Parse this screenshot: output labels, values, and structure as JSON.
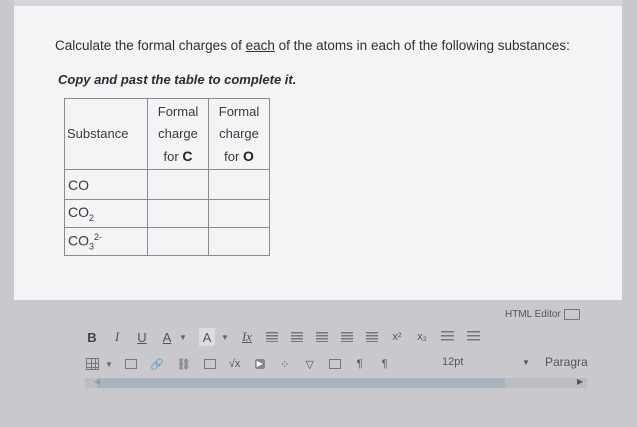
{
  "question": {
    "prompt_before": "Calculate the formal charges of ",
    "prompt_emphasis": "each",
    "prompt_after": " of the atoms in each of the following substances:",
    "instruction": "Copy and past the table to complete it."
  },
  "table": {
    "headers": {
      "substance": "Substance",
      "col1_line1": "Formal",
      "col1_line2": "charge",
      "col1_line3": "for",
      "col1_atom": "C",
      "col2_line1": "Formal",
      "col2_line2": "charge",
      "col2_line3": "for",
      "col2_atom": "O"
    },
    "rows": [
      {
        "base": "CO",
        "sub": "",
        "sup": ""
      },
      {
        "base": "CO",
        "sub": "2",
        "sup": ""
      },
      {
        "base": "CO",
        "sub": "3",
        "sup": "2-"
      }
    ]
  },
  "editor": {
    "label": "HTML Editor",
    "toolbar1": {
      "bold": "B",
      "italic": "I",
      "underline": "U",
      "font_color": "A",
      "highlight": "A",
      "clear_format": "Ix",
      "superscript": "x²",
      "subscript": "x₂"
    },
    "toolbar2": {
      "ltr": "¶",
      "rtl": "¶",
      "font_size": "12pt",
      "paragraph": "Paragra"
    }
  },
  "icons": [
    "table-icon",
    "media-icon",
    "link-icon",
    "unlink-icon",
    "image-icon",
    "equation-icon",
    "youtube-icon",
    "emoji-icon",
    "expand-icon",
    "media-embed-icon",
    "keyboard-icon",
    "align-left-icon",
    "align-center-icon",
    "align-right-icon",
    "justify-icon",
    "bullet-list-icon",
    "numbered-list-icon"
  ]
}
